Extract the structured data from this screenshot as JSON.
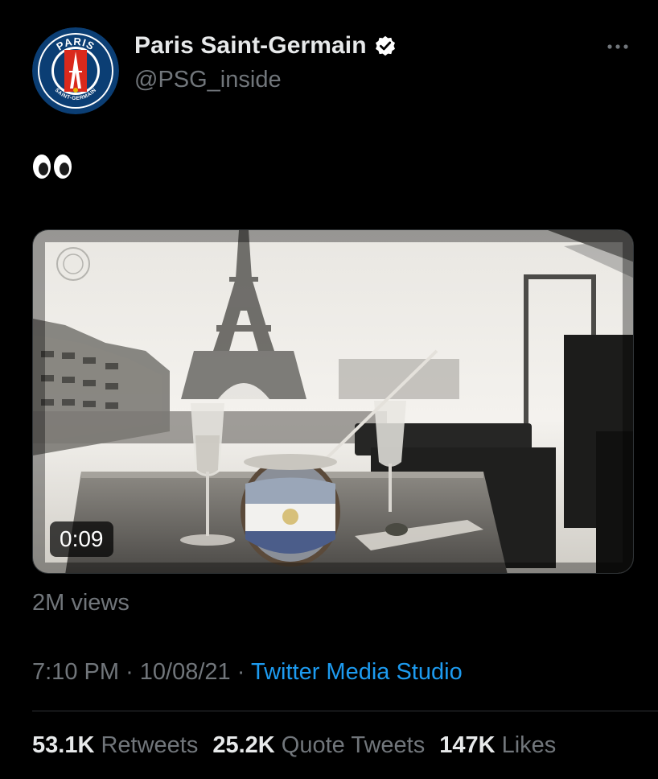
{
  "author": {
    "display_name": "Paris Saint-Germain",
    "handle": "@PSG_inside",
    "verified": true,
    "avatar_icon": "psg-crest-icon",
    "avatar_text_top": "PARIS",
    "avatar_text_bottom": "SAINT-GERMAIN"
  },
  "tweet": {
    "text_emoji": "eyes-emoji"
  },
  "media": {
    "type": "video",
    "duration": "0:09"
  },
  "views": "2M views",
  "meta": {
    "time": "7:10 PM",
    "separator": "·",
    "date": "10/08/21",
    "source": "Twitter Media Studio"
  },
  "stats": {
    "retweets_count": "53.1K",
    "retweets_label": "Retweets",
    "quotes_count": "25.2K",
    "quotes_label": "Quote Tweets",
    "likes_count": "147K",
    "likes_label": "Likes"
  },
  "colors": {
    "background": "#000000",
    "text_primary": "#e7e9ea",
    "text_secondary": "#71767b",
    "link": "#1d9bf0",
    "psg_blue": "#004170",
    "psg_red": "#da291c"
  }
}
